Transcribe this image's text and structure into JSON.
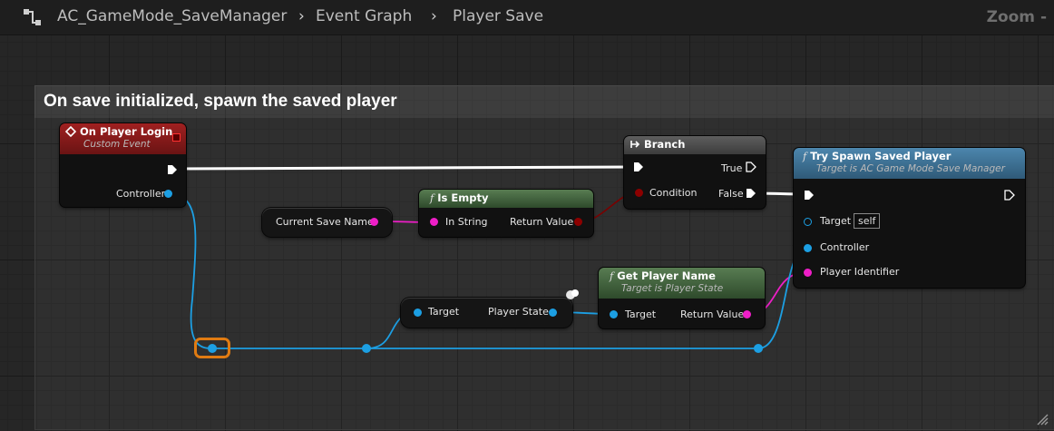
{
  "breadcrumb": {
    "blueprint": "AC_GameMode_SaveManager",
    "graph": "Event Graph",
    "function": "Player Save",
    "zoom": "Zoom -"
  },
  "comment": {
    "title": "On save initialized, spawn the saved player"
  },
  "nodes": {
    "on_player_login": {
      "title": "On Player Login",
      "subtitle": "Custom Event",
      "pin_controller": "Controller"
    },
    "branch": {
      "title": "Branch",
      "pin_condition": "Condition",
      "pin_true": "True",
      "pin_false": "False"
    },
    "is_empty": {
      "title": "Is Empty",
      "pin_in": "In String",
      "pin_out": "Return Value"
    },
    "current_save_name": {
      "label": "Current Save Name"
    },
    "player_state": {
      "pin_in": "Target",
      "pin_out": "Player State"
    },
    "get_player_name": {
      "title": "Get Player Name",
      "subtitle": "Target is Player State",
      "pin_target": "Target",
      "pin_out": "Return Value"
    },
    "try_spawn": {
      "title": "Try Spawn Saved Player",
      "subtitle": "Target is AC Game Mode Save Manager",
      "pin_target": "Target",
      "target_value": "self",
      "pin_controller": "Controller",
      "pin_player_identifier": "Player Identifier"
    }
  },
  "colors": {
    "event_header": "#8b1d1d",
    "pure_function_header": "#3f5c3b",
    "function_header": "#3d6a8a",
    "exec_wire": "#ffffff",
    "object_wire": "#1c9fe3",
    "string_wire": "#ee1ec7",
    "bool_wire": "#8c0000",
    "selection": "#e07b12"
  }
}
